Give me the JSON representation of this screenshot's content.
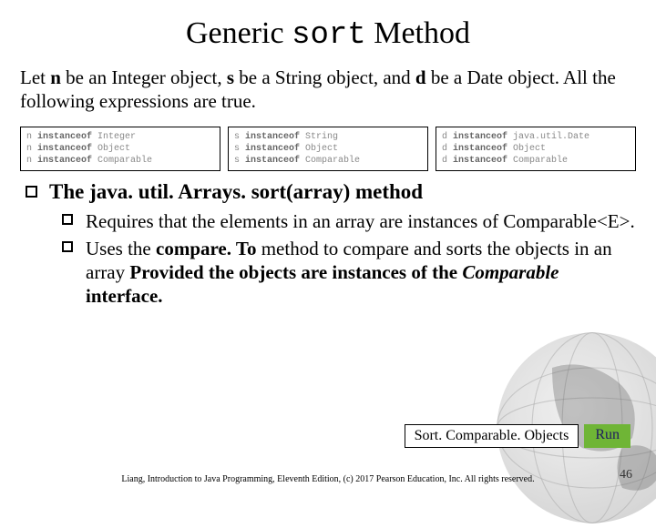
{
  "title": {
    "pre": "Generic ",
    "code": "sort",
    "post": " Method"
  },
  "lead": {
    "p1": "Let ",
    "n": "n",
    "p2": " be an Integer object, ",
    "s": "s",
    "p3": " be a String object, and ",
    "d": "d",
    "p4": " be a Date object. All the following expressions are true."
  },
  "codeboxes": {
    "c1l1a": "n ",
    "c1l1k": "instanceof",
    "c1l1b": " Integer",
    "c1l2a": "n ",
    "c1l2k": "instanceof",
    "c1l2b": " Object",
    "c1l3a": "n ",
    "c1l3k": "instanceof",
    "c1l3b": " Comparable",
    "c2l1a": "s ",
    "c2l1k": "instanceof",
    "c2l1b": " String",
    "c2l2a": "s ",
    "c2l2k": "instanceof",
    "c2l2b": " Object",
    "c2l3a": "s ",
    "c2l3k": "instanceof",
    "c2l3b": " Comparable",
    "c3l1a": "d ",
    "c3l1k": "instanceof",
    "c3l1b": " java.util.Date",
    "c3l2a": "d ",
    "c3l2k": "instanceof",
    "c3l2b": " Object",
    "c3l3a": "d ",
    "c3l3k": "instanceof",
    "c3l3b": " Comparable"
  },
  "bullet1": "The java. util. Arrays. sort(array) method",
  "sub1": "Requires that the elements in an array are instances of Comparable<E>.",
  "sub2a": "Uses the ",
  "sub2b": "compare. To",
  "sub2c": " method to compare and sorts the objects in an array ",
  "sub2d": "Provided the objects are instances of the ",
  "sub2e": "Comparable",
  "sub2f": " interface.",
  "linkLabel": "Sort. Comparable. Objects",
  "runLabel": "Run",
  "footer": "Liang, Introduction to Java Programming, Eleventh Edition, (c) 2017 Pearson Education, Inc. All rights reserved.",
  "pagenum": "46"
}
